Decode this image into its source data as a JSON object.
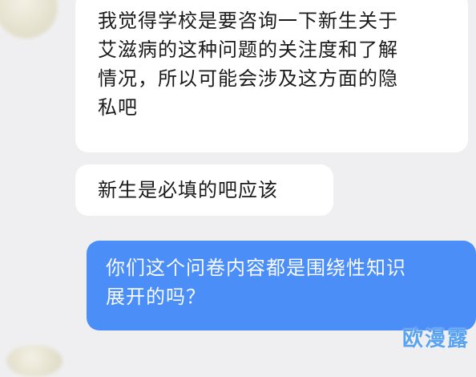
{
  "chat": {
    "messages": [
      {
        "sender": "other",
        "lines": [
          "我觉得学校是要咨询一下新生关于",
          "艾滋病的这种问题的关注度和了解",
          "情况，所以可能会涉及这方面的隐",
          "私吧"
        ]
      },
      {
        "sender": "other",
        "lines": [
          "新生是必填的吧应该"
        ]
      },
      {
        "sender": "self",
        "lines": [
          "你们这个问卷内容都是围绕性知识",
          "展开的吗？"
        ]
      }
    ]
  },
  "watermark": {
    "text": "欧漫露"
  },
  "colors": {
    "background": "#efeff1",
    "incoming_bubble": "#ffffff",
    "outgoing_bubble": "#4b8ef8",
    "watermark": "#5aa3f0"
  }
}
